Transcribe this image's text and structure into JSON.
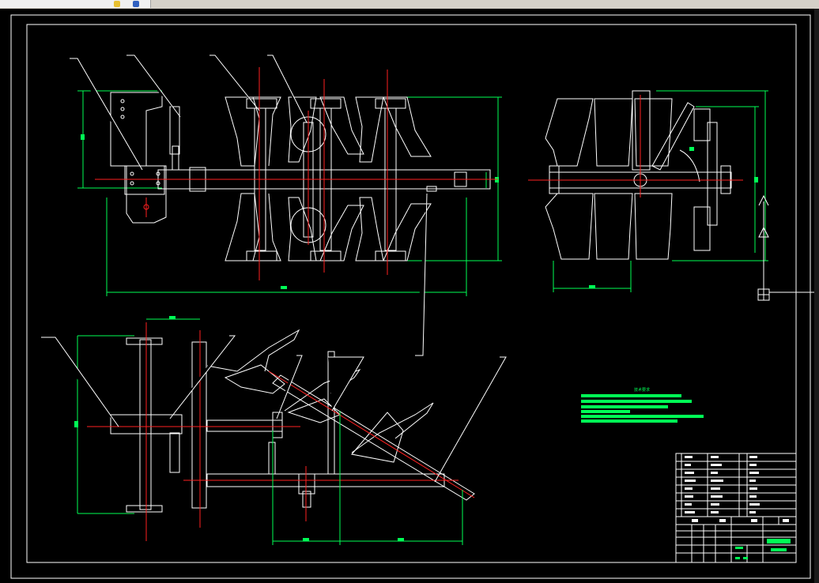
{
  "app": {
    "background": "#000000",
    "toolbar_color": "#d4d0c8"
  },
  "colors": {
    "line": "#ffffff",
    "center": "#ff2020",
    "dimension": "#00ff55",
    "leader": "#ffffff"
  },
  "toolbar": {
    "icons": [
      "yellow-tool-icon",
      "blue-tool-icon"
    ]
  },
  "tech_notes": {
    "title": "技术要求",
    "line_count": 6
  },
  "title_block": {
    "cells": 14
  }
}
